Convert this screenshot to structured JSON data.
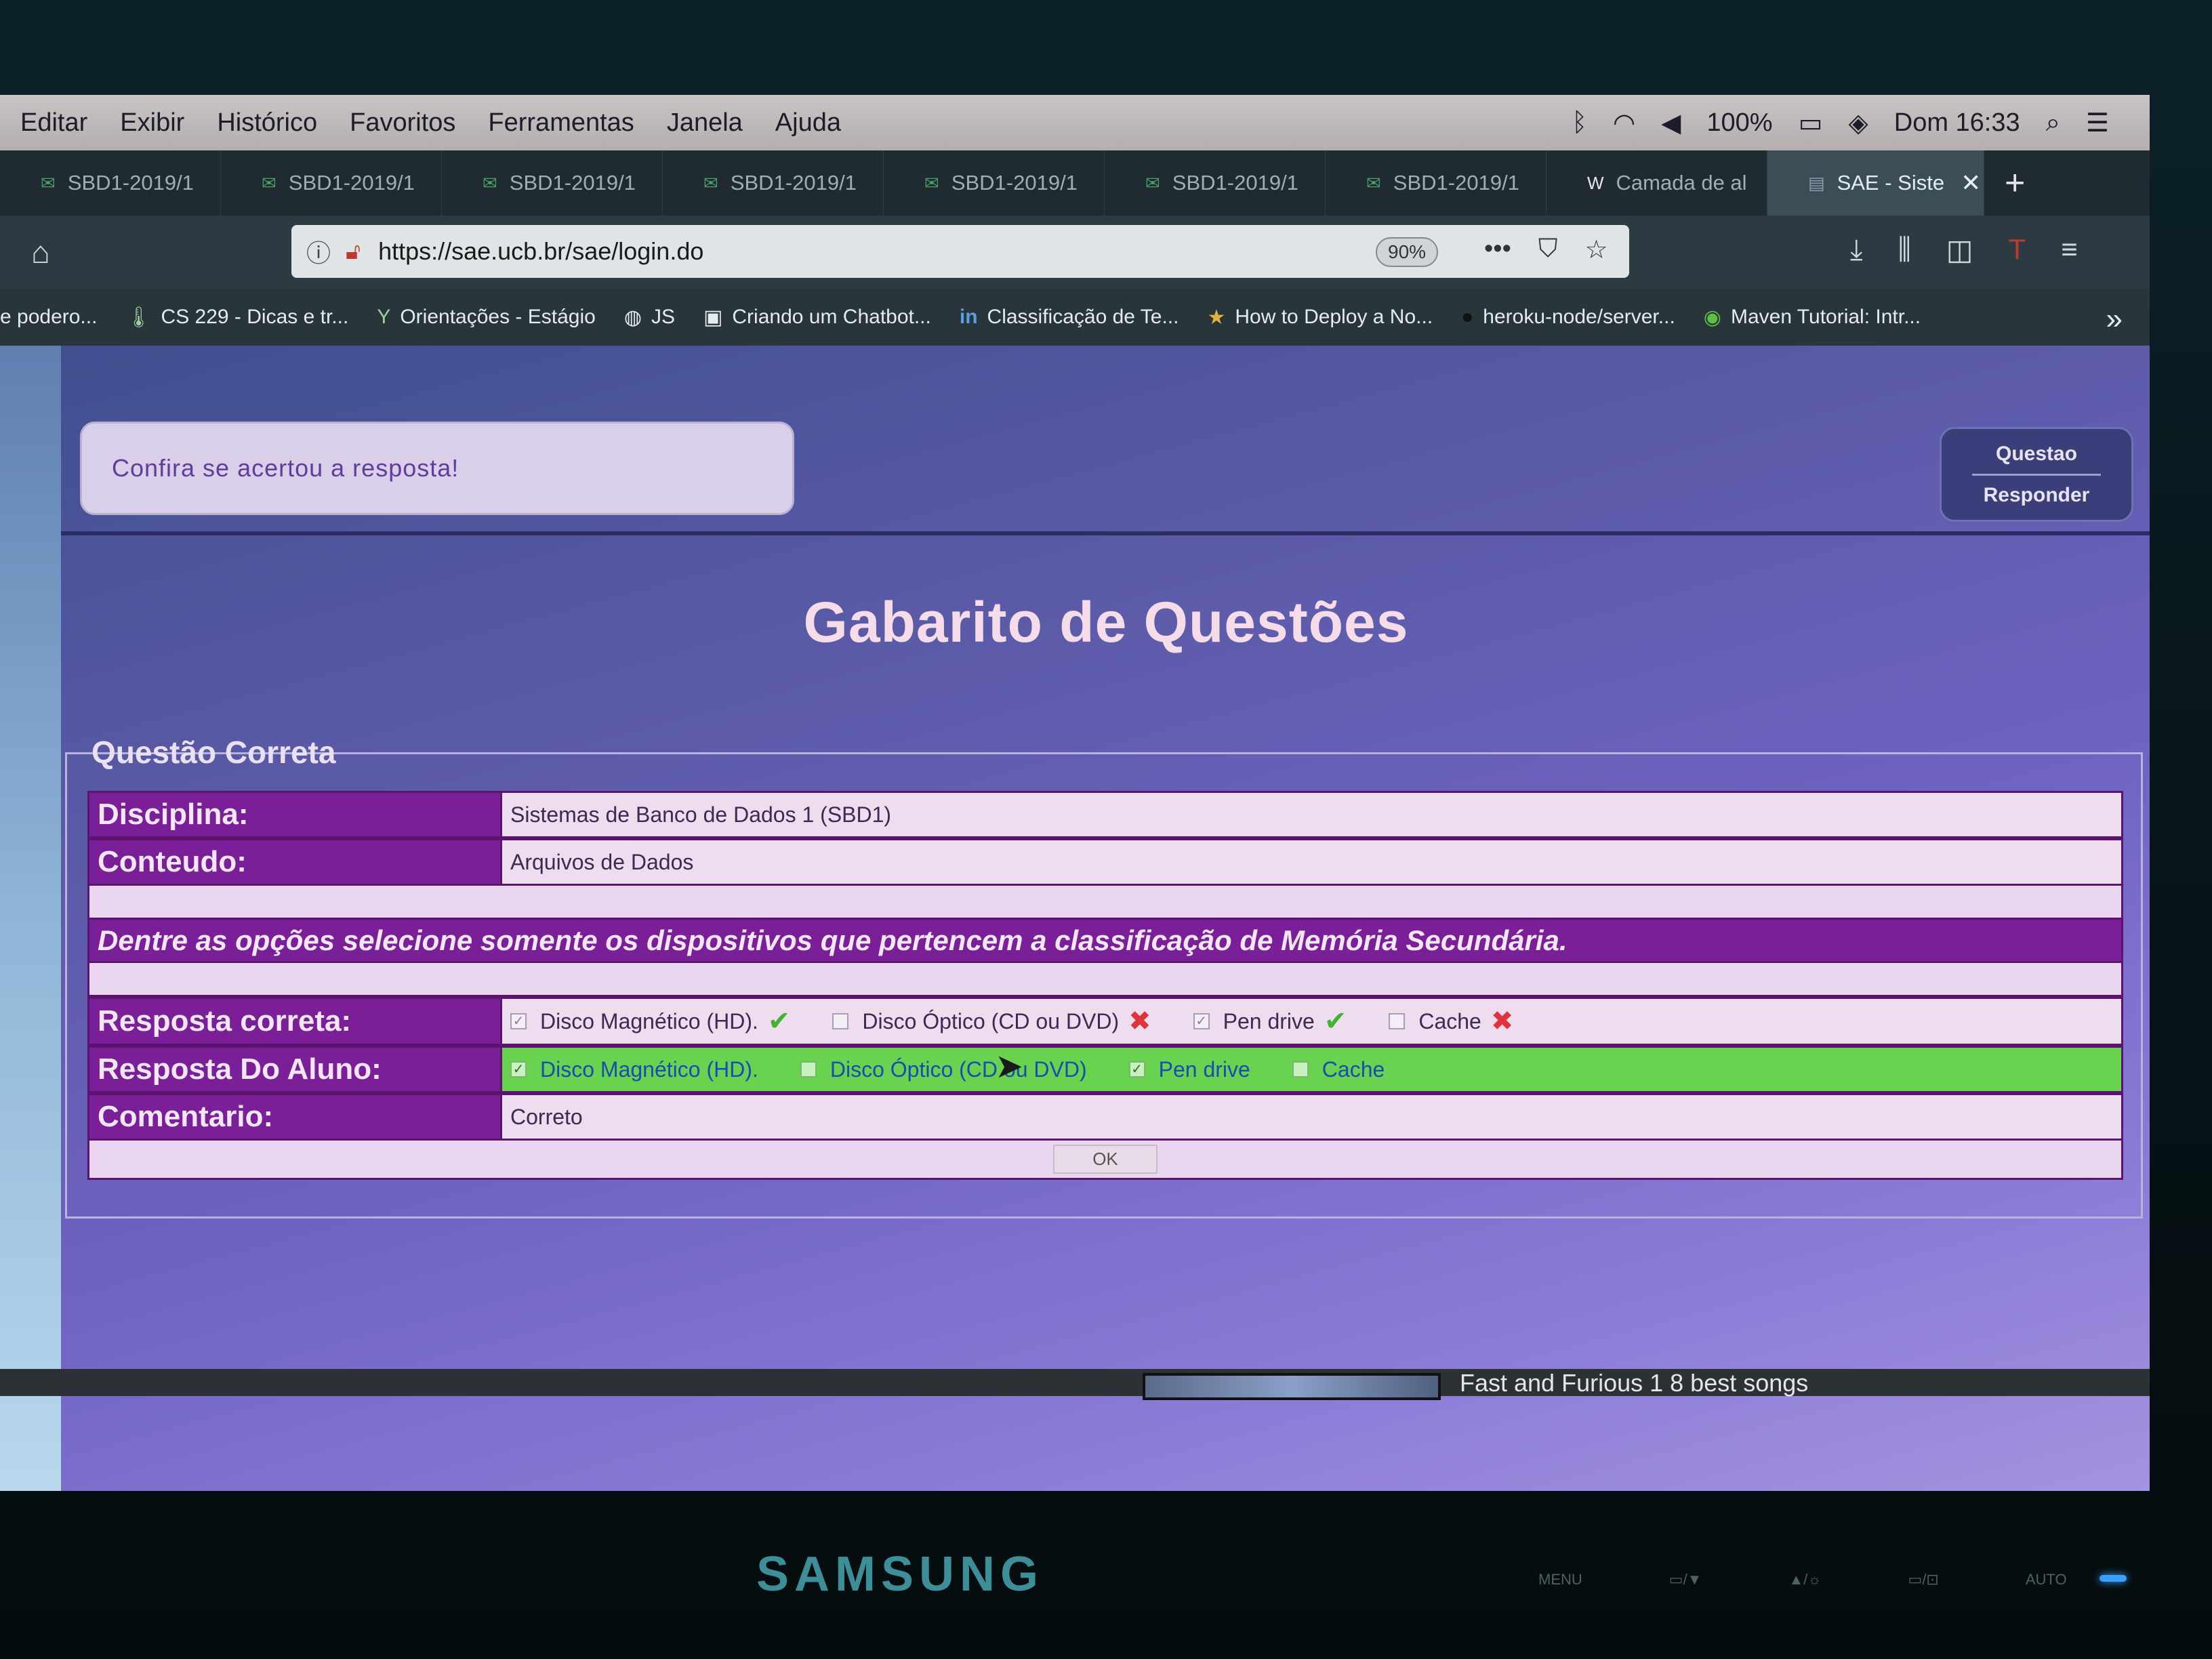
{
  "menubar": {
    "items": [
      "Editar",
      "Exibir",
      "Histórico",
      "Favoritos",
      "Ferramentas",
      "Janela",
      "Ajuda"
    ],
    "battery": "100%",
    "clock": "Dom 16:33"
  },
  "tabs": [
    {
      "label": "SBD1-2019/1"
    },
    {
      "label": "SBD1-2019/1"
    },
    {
      "label": "SBD1-2019/1"
    },
    {
      "label": "SBD1-2019/1"
    },
    {
      "label": "SBD1-2019/1"
    },
    {
      "label": "SBD1-2019/1"
    },
    {
      "label": "SBD1-2019/1"
    },
    {
      "label": "Camada de al"
    },
    {
      "label": "SAE - Siste",
      "active": true
    }
  ],
  "navbar": {
    "url": "https://sae.ucb.br/sae/login.do",
    "zoom": "90%"
  },
  "bookmarks": [
    "e podero...",
    "CS 229 - Dicas e tr...",
    "Orientações - Estágio",
    "JS",
    "Criando um Chatbot...",
    "Classificação de Te...",
    "How to Deploy a No...",
    "heroku-node/server...",
    "Maven Tutorial: Intr..."
  ],
  "page": {
    "feedback": "Confira se acertou a resposta!",
    "question_button": {
      "line1": "Questao",
      "line2": "Responder"
    },
    "title": "Gabarito de Questões",
    "legend": "Questão Correta",
    "rows": {
      "disciplina_label": "Disciplina:",
      "disciplina_value": "Sistemas de Banco de Dados 1 (SBD1)",
      "conteudo_label": "Conteudo:",
      "conteudo_value": "Arquivos de Dados",
      "statement": "Dentre as opções selecione somente os dispositivos que pertencem a classificação de Memória Secundária.",
      "correct_label": "Resposta correta:",
      "student_label": "Resposta Do Aluno:",
      "comment_label": "Comentario:",
      "comment_value": "Correto",
      "ok": "OK"
    },
    "options": [
      {
        "label": "Disco Magnético (HD).",
        "checked": true,
        "correct": true
      },
      {
        "label": "Disco Óptico (CD ou DVD)",
        "checked": false,
        "correct": false
      },
      {
        "label": "Pen drive",
        "checked": true,
        "correct": true
      },
      {
        "label": "Cache",
        "checked": false,
        "correct": false
      }
    ]
  },
  "taskbar": {
    "media_title": "Fast and Furious 1 8 best songs"
  },
  "bezel": {
    "brand": "SAMSUNG",
    "controls": [
      "MENU",
      "▭/▼",
      "▲/☼",
      "▭/⊡",
      "AUTO"
    ]
  },
  "colors": {
    "label_bg": "#7a1f97",
    "student_row_bg": "#69d24e",
    "title": "#f5dce8"
  }
}
